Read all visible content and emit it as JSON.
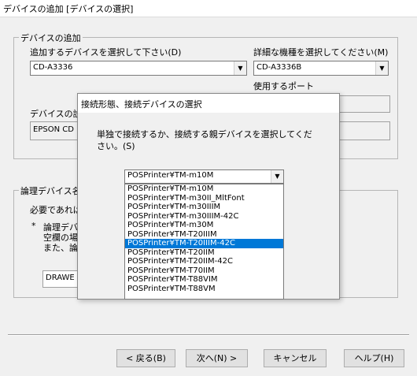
{
  "window": {
    "title": "デバイスの追加 [デバイスの選択]"
  },
  "device_group": {
    "legend": "デバイスの追加",
    "device_select_label": "追加するデバイスを選択して下さい(D)",
    "device_select_value": "CD-A3336",
    "model_select_label": "詳細な機種を選択してください(M)",
    "model_select_value": "CD-A3336B",
    "port_label": "使用するポート",
    "description_label": "デバイスの説",
    "description_value": "EPSON CD"
  },
  "logical_group": {
    "legend": "論理デバイス名",
    "note1": "必要であれば",
    "note2_bullet": "*",
    "note2_line1": "論理デバ",
    "note2_line2": "空欄の場",
    "note2_line3": "また、論理",
    "name_value": "DRAWE"
  },
  "buttons": {
    "back": "< 戻る(B)",
    "next": "次へ(N) >",
    "cancel": "キャンセル",
    "help": "ヘルプ(H)"
  },
  "dialog": {
    "title": "接続形態、接続デバイスの選択",
    "message": "単独で接続するか、接続する親デバイスを選択してください。(S)",
    "combo_value": "POSPrinter¥TM-m10M",
    "options": [
      "POSPrinter¥TM-m10M",
      "POSPrinter¥TM-m30II_MltFont",
      "POSPrinter¥TM-m30IIIM",
      "POSPrinter¥TM-m30IIIM-42C",
      "POSPrinter¥TM-m30M",
      "POSPrinter¥TM-T20IIIM",
      "POSPrinter¥TM-T20IIIM-42C",
      "POSPrinter¥TM-T20IIM",
      "POSPrinter¥TM-T20IIM-42C",
      "POSPrinter¥TM-T70IIM",
      "POSPrinter¥TM-T88VIM",
      "POSPrinter¥TM-T88VM"
    ],
    "selected_option": "POSPrinter¥TM-T20IIIM-42C"
  },
  "colors": {
    "selection": "#0078d7",
    "window_bg": "#f0f0f0"
  }
}
